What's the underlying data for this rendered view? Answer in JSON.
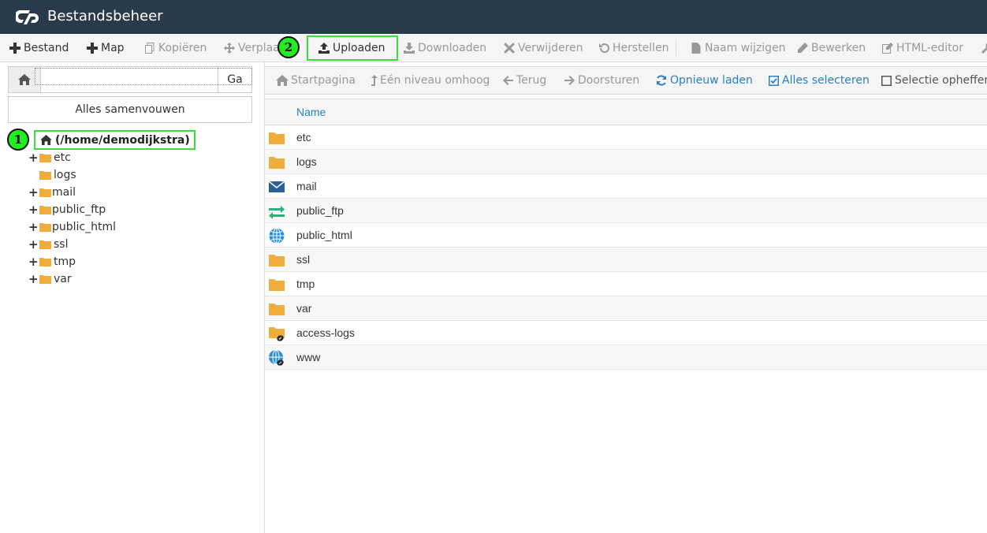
{
  "app": {
    "title": "Bestandsbeheer"
  },
  "toolbar": {
    "items": [
      {
        "label": "Bestand",
        "icon": "plus-icon"
      },
      {
        "label": "Map",
        "icon": "plus-icon"
      },
      {
        "label": "Kopiëren",
        "icon": "copy-icon"
      },
      {
        "label": "Verplaa",
        "icon": "move-icon"
      },
      {
        "label": "Uploaden",
        "icon": "upload-icon"
      },
      {
        "label": "Downloaden",
        "icon": "download-icon"
      },
      {
        "label": "Verwijderen",
        "icon": "x-icon"
      },
      {
        "label": "Herstellen",
        "icon": "undo-icon"
      },
      {
        "label": "Naam wijzigen",
        "icon": "file-icon"
      },
      {
        "label": "Bewerken",
        "icon": "pencil-icon"
      },
      {
        "label": "HTML-editor",
        "icon": "edit-box-icon"
      }
    ]
  },
  "annotations": {
    "one": "1",
    "two": "2",
    "highlight_color": "#3cdc3c"
  },
  "path": {
    "value": "",
    "go_label": "Ga"
  },
  "sidebar": {
    "collapse_label": "Alles samenvouwen",
    "root_label": "(/home/demodijkstra)",
    "items": [
      {
        "label": "etc",
        "expandable": true
      },
      {
        "label": "logs",
        "expandable": false
      },
      {
        "label": "mail",
        "expandable": true
      },
      {
        "label": "public_ftp",
        "expandable": true
      },
      {
        "label": "public_html",
        "expandable": true
      },
      {
        "label": "ssl",
        "expandable": true
      },
      {
        "label": "tmp",
        "expandable": true
      },
      {
        "label": "var",
        "expandable": true
      }
    ]
  },
  "nav": {
    "items": [
      {
        "label": "Startpagina",
        "icon": "home-icon"
      },
      {
        "label": "Eén niveau omhoog",
        "icon": "level-up-icon"
      },
      {
        "label": "Terug",
        "icon": "arrow-left-icon"
      },
      {
        "label": "Doorsturen",
        "icon": "arrow-right-icon"
      },
      {
        "label": "Opnieuw laden",
        "icon": "refresh-icon"
      },
      {
        "label": "Alles selecteren",
        "icon": "check-square-icon"
      },
      {
        "label": "Selectie opheffen",
        "icon": "square-icon"
      }
    ]
  },
  "table": {
    "column_name": "Name",
    "rows": [
      {
        "name": "etc",
        "icon": "folder-icon"
      },
      {
        "name": "logs",
        "icon": "folder-icon"
      },
      {
        "name": "mail",
        "icon": "mail-icon"
      },
      {
        "name": "public_ftp",
        "icon": "transfer-icon"
      },
      {
        "name": "public_html",
        "icon": "globe-icon"
      },
      {
        "name": "ssl",
        "icon": "folder-icon"
      },
      {
        "name": "tmp",
        "icon": "folder-icon"
      },
      {
        "name": "var",
        "icon": "folder-icon"
      },
      {
        "name": "access-logs",
        "icon": "folder-link-icon"
      },
      {
        "name": "www",
        "icon": "globe-link-icon"
      }
    ]
  },
  "colors": {
    "topbar": "#293a4a",
    "accent": "#2a7fc0",
    "folder": "#f0ad3c"
  }
}
